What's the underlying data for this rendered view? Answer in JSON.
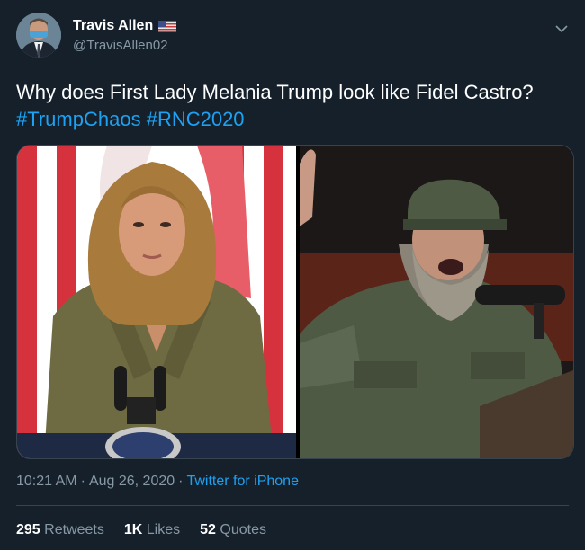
{
  "author": {
    "display_name": "Travis Allen",
    "handle": "@TravisAllen02",
    "flag_icon": "us-flag-icon"
  },
  "tweet": {
    "text_before": "Why does First Lady Melania Trump look like Fidel Castro? ",
    "hashtags": [
      "#TrumpChaos",
      "#RNC2020"
    ]
  },
  "meta": {
    "time": "10:21 AM",
    "separator": "·",
    "date": "Aug 26, 2020",
    "source": "Twitter for iPhone"
  },
  "stats": {
    "retweets_count": "295",
    "retweets_label": "Retweets",
    "likes_count": "1K",
    "likes_label": "Likes",
    "quotes_count": "52",
    "quotes_label": "Quotes"
  },
  "colors": {
    "background": "#15202b",
    "link": "#1da1f2",
    "secondary_text": "#8899a6",
    "border": "#38444d"
  }
}
